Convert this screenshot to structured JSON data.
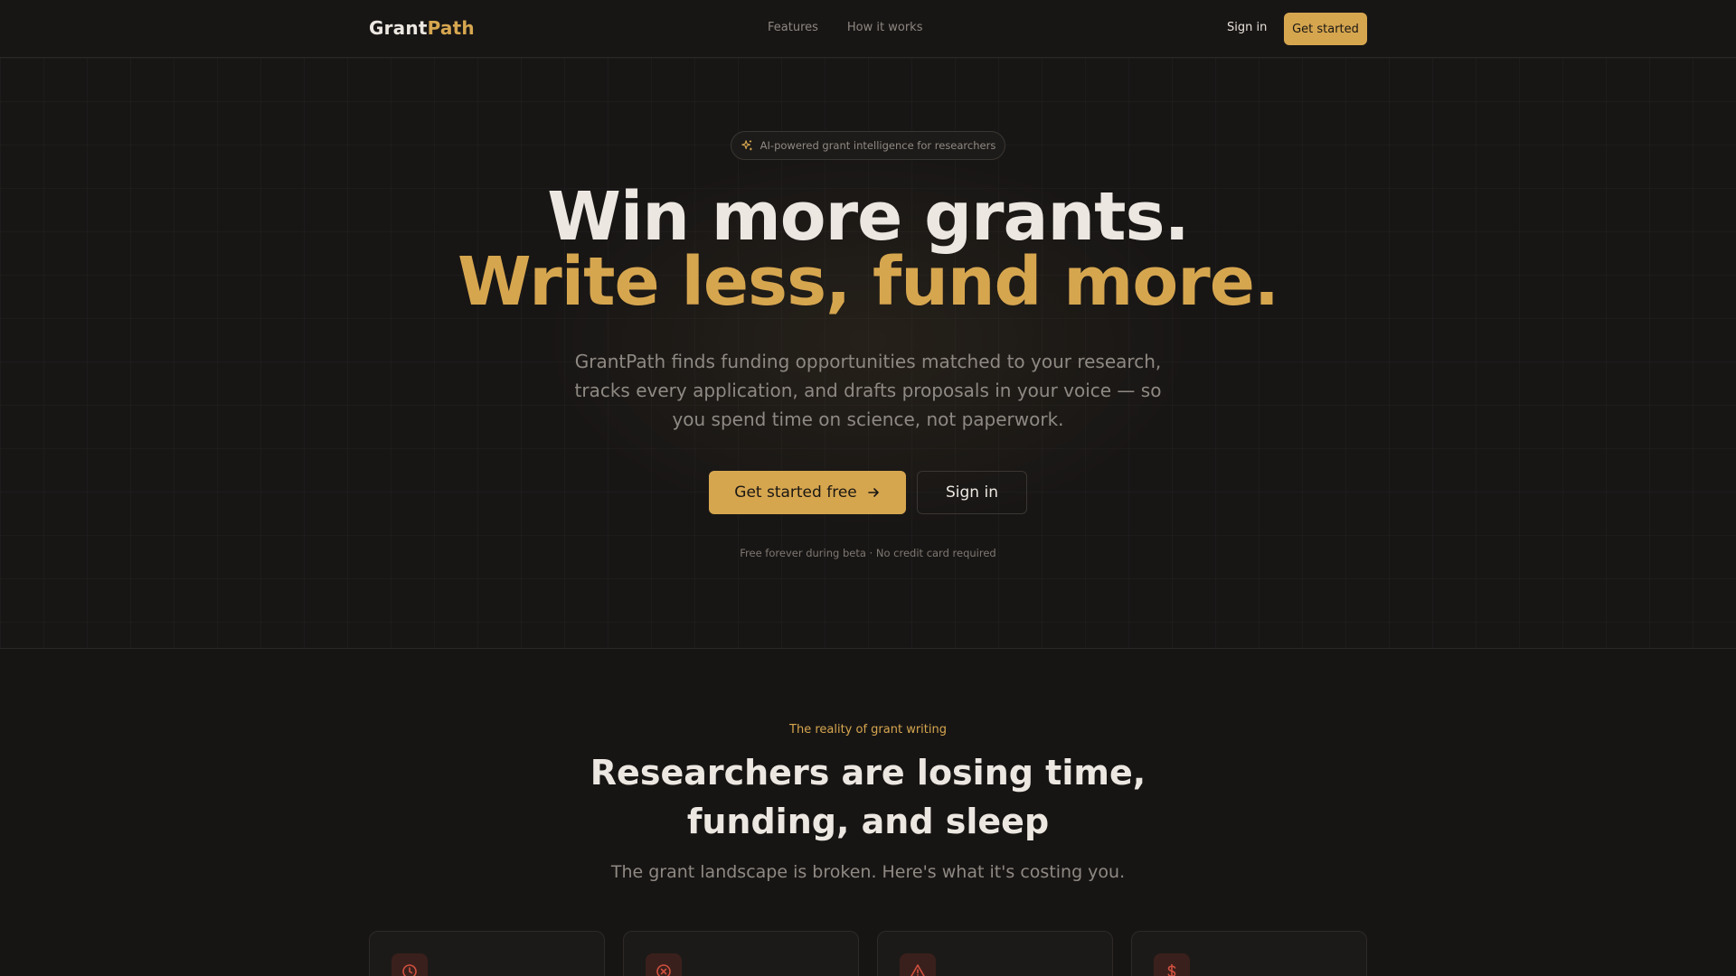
{
  "nav": {
    "logo_primary": "Grant",
    "logo_accent": "Path",
    "links": [
      "Features",
      "How it works"
    ],
    "sign_in": "Sign in",
    "cta": "Get started"
  },
  "hero": {
    "badge": "AI-powered grant intelligence for researchers",
    "badge_icon": "sparkle-icon",
    "headline_line1": "Win more grants.",
    "headline_line2": "Write less, fund more.",
    "subtext": "GrantPath finds funding opportunities matched to your research, tracks every application, and drafts proposals in your voice — so you spend time on science, not paperwork.",
    "primary_button": "Get started free",
    "primary_button_icon": "arrow-right-icon",
    "secondary_button": "Sign in",
    "fineprint": "Free forever during beta · No credit card required"
  },
  "reality": {
    "eyebrow": "The reality of grant writing",
    "title": "Researchers are losing time, funding, and sleep",
    "subtitle": "The grant landscape is broken. Here's what it's costing you.",
    "cards": [
      {
        "icon": "clock-icon"
      },
      {
        "icon": "x-circle-icon"
      },
      {
        "icon": "warning-triangle-icon"
      },
      {
        "icon": "dollar-icon"
      }
    ]
  },
  "colors": {
    "background": "#171514",
    "accent": "#d6a64f",
    "text": "#ece7e1",
    "muted": "#8f8983",
    "danger_icon": "#d0503f"
  }
}
